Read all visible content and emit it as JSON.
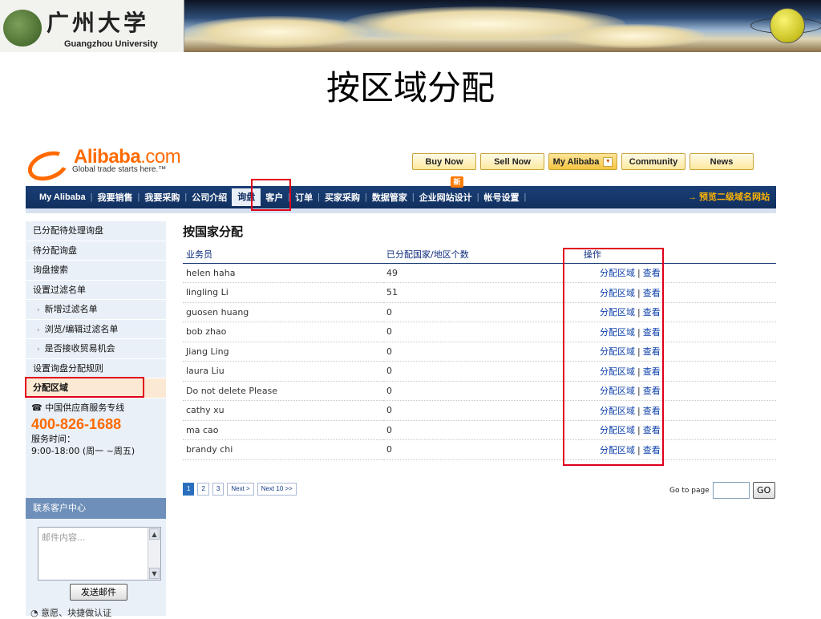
{
  "banner": {
    "university_cn": "广州大学",
    "university_en": "Guangzhou University"
  },
  "slide_title": "按区域分配",
  "alibaba": {
    "brand": "Alibaba",
    "brand_domain": ".com",
    "tagline": "Global trade starts here.™",
    "top_buttons": [
      "Buy Now",
      "Sell Now",
      "My Alibaba",
      "Community",
      "News"
    ],
    "nav": [
      "My Alibaba",
      "我要销售",
      "我要采购",
      "公司介绍",
      "询盘",
      "客户",
      "订单",
      "买家采购",
      "数据管家",
      "企业网站设计",
      "帐号设置"
    ],
    "nav_new_badge": "新",
    "nav_right": "→ 预览二级域名网站"
  },
  "sidebar": {
    "items": [
      "已分配待处理询盘",
      "待分配询盘",
      "询盘搜索",
      "设置过滤名单",
      "新增过滤名单",
      "浏览/编辑过滤名单",
      "是否接收贸易机会",
      "设置询盘分配规则",
      "分配区域"
    ],
    "service_label": "中国供应商服务专线",
    "service_phone": "400-826-1688",
    "service_hours_label": "服务时间：",
    "service_hours": "9:00-18:00 (周一 ~周五)",
    "contact_header": "联系客户中心",
    "mail_placeholder": "邮件内容...",
    "send_button": "发送邮件",
    "bottom_text": "意愿、块捷做认证"
  },
  "main": {
    "heading": "按国家分配",
    "columns": [
      "业务员",
      "已分配国家/地区个数",
      "操作"
    ],
    "rows": [
      {
        "name": "helen haha",
        "count": "49"
      },
      {
        "name": "lingling Li",
        "count": "51"
      },
      {
        "name": "guosen huang",
        "count": "0"
      },
      {
        "name": "bob zhao",
        "count": "0"
      },
      {
        "name": "Jiang Ling",
        "count": "0"
      },
      {
        "name": "laura Liu",
        "count": "0"
      },
      {
        "name": "Do not delete Please",
        "count": "0"
      },
      {
        "name": "cathy xu",
        "count": "0"
      },
      {
        "name": "ma cao",
        "count": "0"
      },
      {
        "name": "brandy chi",
        "count": "0"
      }
    ],
    "action_assign": "分配区域",
    "action_view": "查看",
    "pager": [
      "1",
      "2",
      "3",
      "Next >",
      "Next 10 >>"
    ],
    "goto_label": "Go to page",
    "goto_button": "GO"
  },
  "colors": {
    "highlight": "#e0001a",
    "alibaba_orange": "#ff6a00",
    "nav_blue": "#1a3f76"
  }
}
